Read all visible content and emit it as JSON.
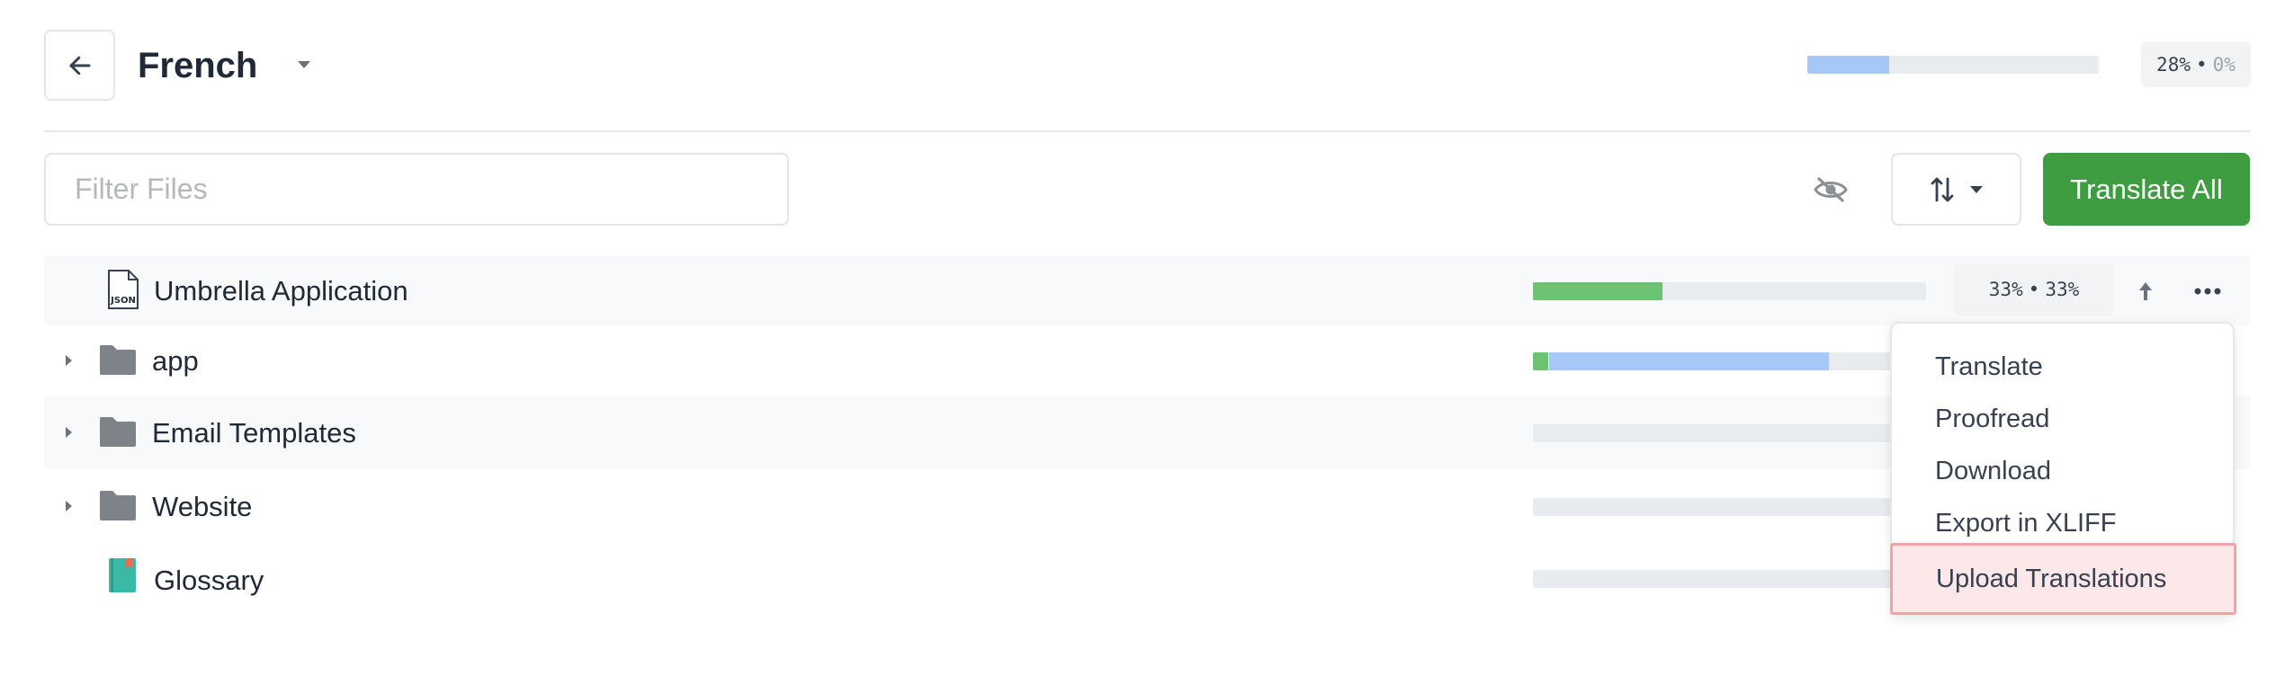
{
  "header": {
    "title": "French",
    "progress_percent": 28,
    "progress_text": "28%",
    "approved_text": "0%"
  },
  "toolbar": {
    "filter_placeholder": "Filter Files",
    "translate_all_label": "Translate All"
  },
  "files": [
    {
      "name": "Umbrella Application",
      "type": "json-file",
      "expandable": false,
      "translated_percent": 33,
      "approved_percent": 33,
      "translated_text": "33%",
      "approved_text": "33%"
    },
    {
      "name": "app",
      "type": "folder",
      "expandable": true,
      "approved_percent": 4,
      "translated_percent": 71
    },
    {
      "name": "Email Templates",
      "type": "folder",
      "expandable": true,
      "translated_percent": 0,
      "approved_percent": 0
    },
    {
      "name": "Website",
      "type": "folder",
      "expandable": true,
      "translated_percent": 0,
      "approved_percent": 0
    },
    {
      "name": "Glossary",
      "type": "glossary",
      "expandable": false,
      "translated_percent": 0,
      "approved_percent": 0
    }
  ],
  "context_menu": {
    "items": [
      "Translate",
      "Proofread",
      "Download",
      "Export in XLIFF",
      "Upload Translations"
    ],
    "highlighted": "Upload Translations"
  },
  "colors": {
    "primary_green": "#3e9c41",
    "approved_green": "#6cc371",
    "translated_blue": "#a5c8f7",
    "highlight_border": "#f2a2a2"
  }
}
